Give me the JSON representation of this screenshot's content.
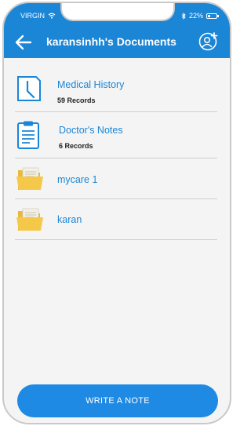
{
  "status_bar": {
    "carrier": "VIRGIN",
    "battery_percent": "22%",
    "battery_level": 0.22,
    "icons": [
      "wifi-icon",
      "bluetooth-icon",
      "battery-icon"
    ]
  },
  "header": {
    "title": "karansinhh's Documents",
    "back_icon": "arrow-left-icon",
    "action_icon": "add-user-icon",
    "background": "#1b85d6"
  },
  "list": {
    "items": [
      {
        "title": "Medical History",
        "subtitle": "59 Records",
        "icon": "clock-document-icon"
      },
      {
        "title": "Doctor's Notes",
        "subtitle": "6 Records",
        "icon": "clipboard-icon"
      },
      {
        "title": "mycare 1",
        "subtitle": "",
        "icon": "folder-icon"
      },
      {
        "title": "karan",
        "subtitle": "",
        "icon": "folder-icon"
      }
    ]
  },
  "footer": {
    "write_note_label": "WRITE A NOTE",
    "button_color": "#1e8ae4"
  },
  "colors": {
    "accent": "#1b85d6",
    "background": "#f4f4f4",
    "folder": "#f6c84a"
  }
}
